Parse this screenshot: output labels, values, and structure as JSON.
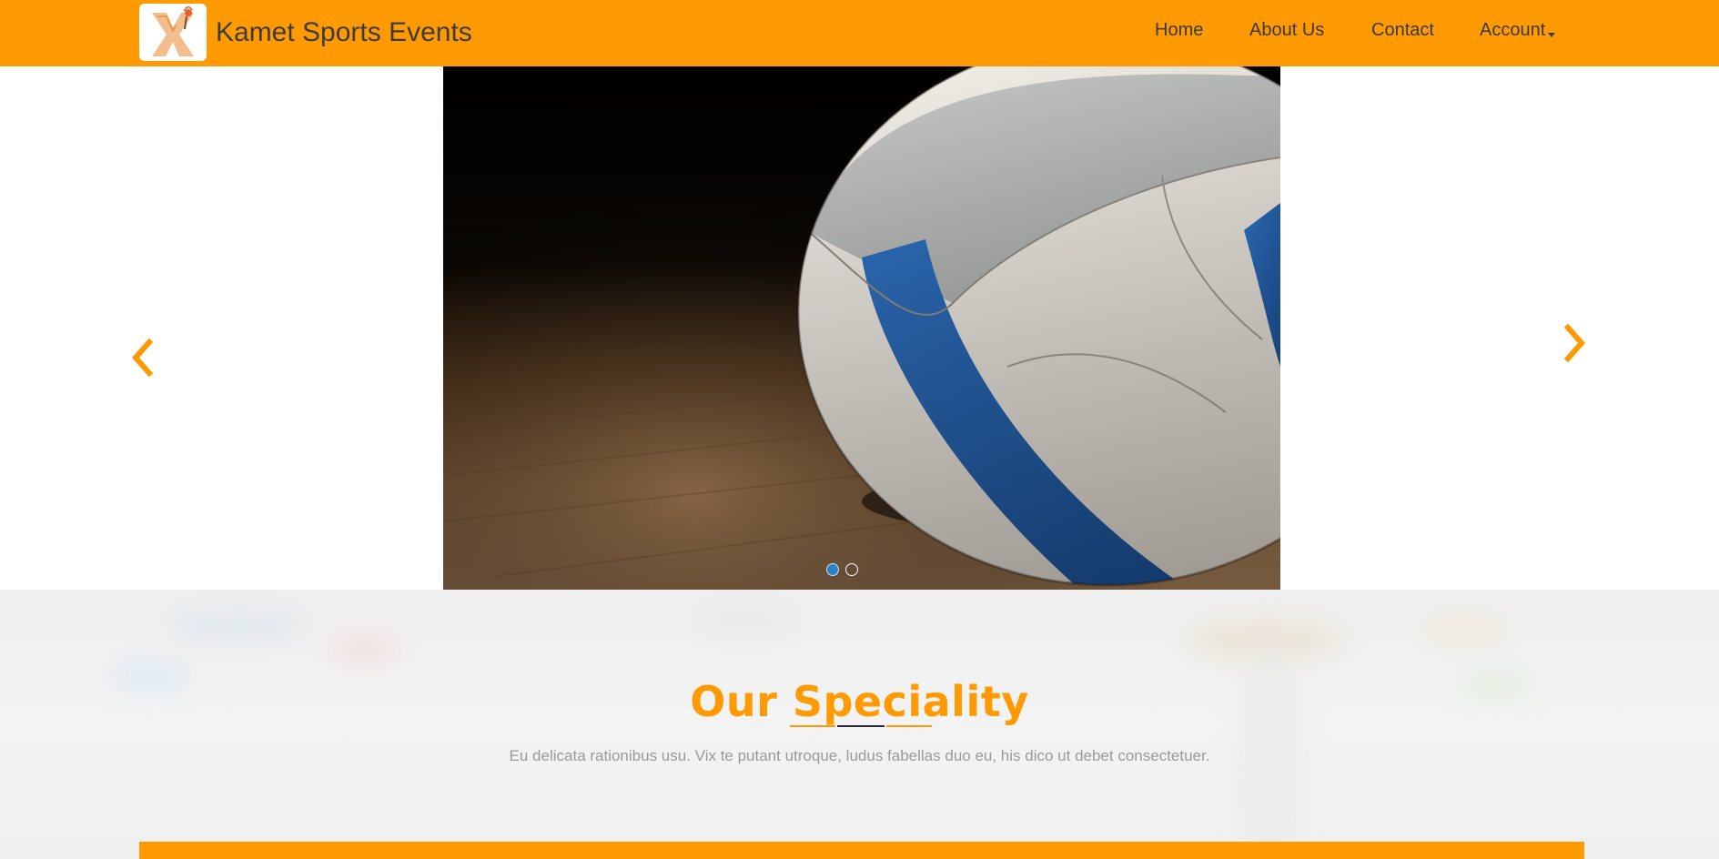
{
  "brand": {
    "name": "Kamet Sports Events",
    "logo": "kamet-logo"
  },
  "nav": {
    "home": "Home",
    "about": "About Us",
    "contact": "Contact",
    "account": "Account"
  },
  "carousel": {
    "slide_image": "volleyball-on-wooden-floor",
    "slides_count": 2,
    "active_slide": 1,
    "prev_icon": "chevron-left-icon",
    "next_icon": "chevron-right-icon"
  },
  "speciality": {
    "title": "Our Speciality",
    "description": "Eu delicata rationibus usu. Vix te putant utroque, ludus fabellas duo eu, his dico ut debet consectetuer."
  },
  "colors": {
    "accent": "#ff9a03",
    "nav_text": "#3a3a3a",
    "indicator_active": "#2f7fc6",
    "muted_text": "#9a9a9a"
  }
}
